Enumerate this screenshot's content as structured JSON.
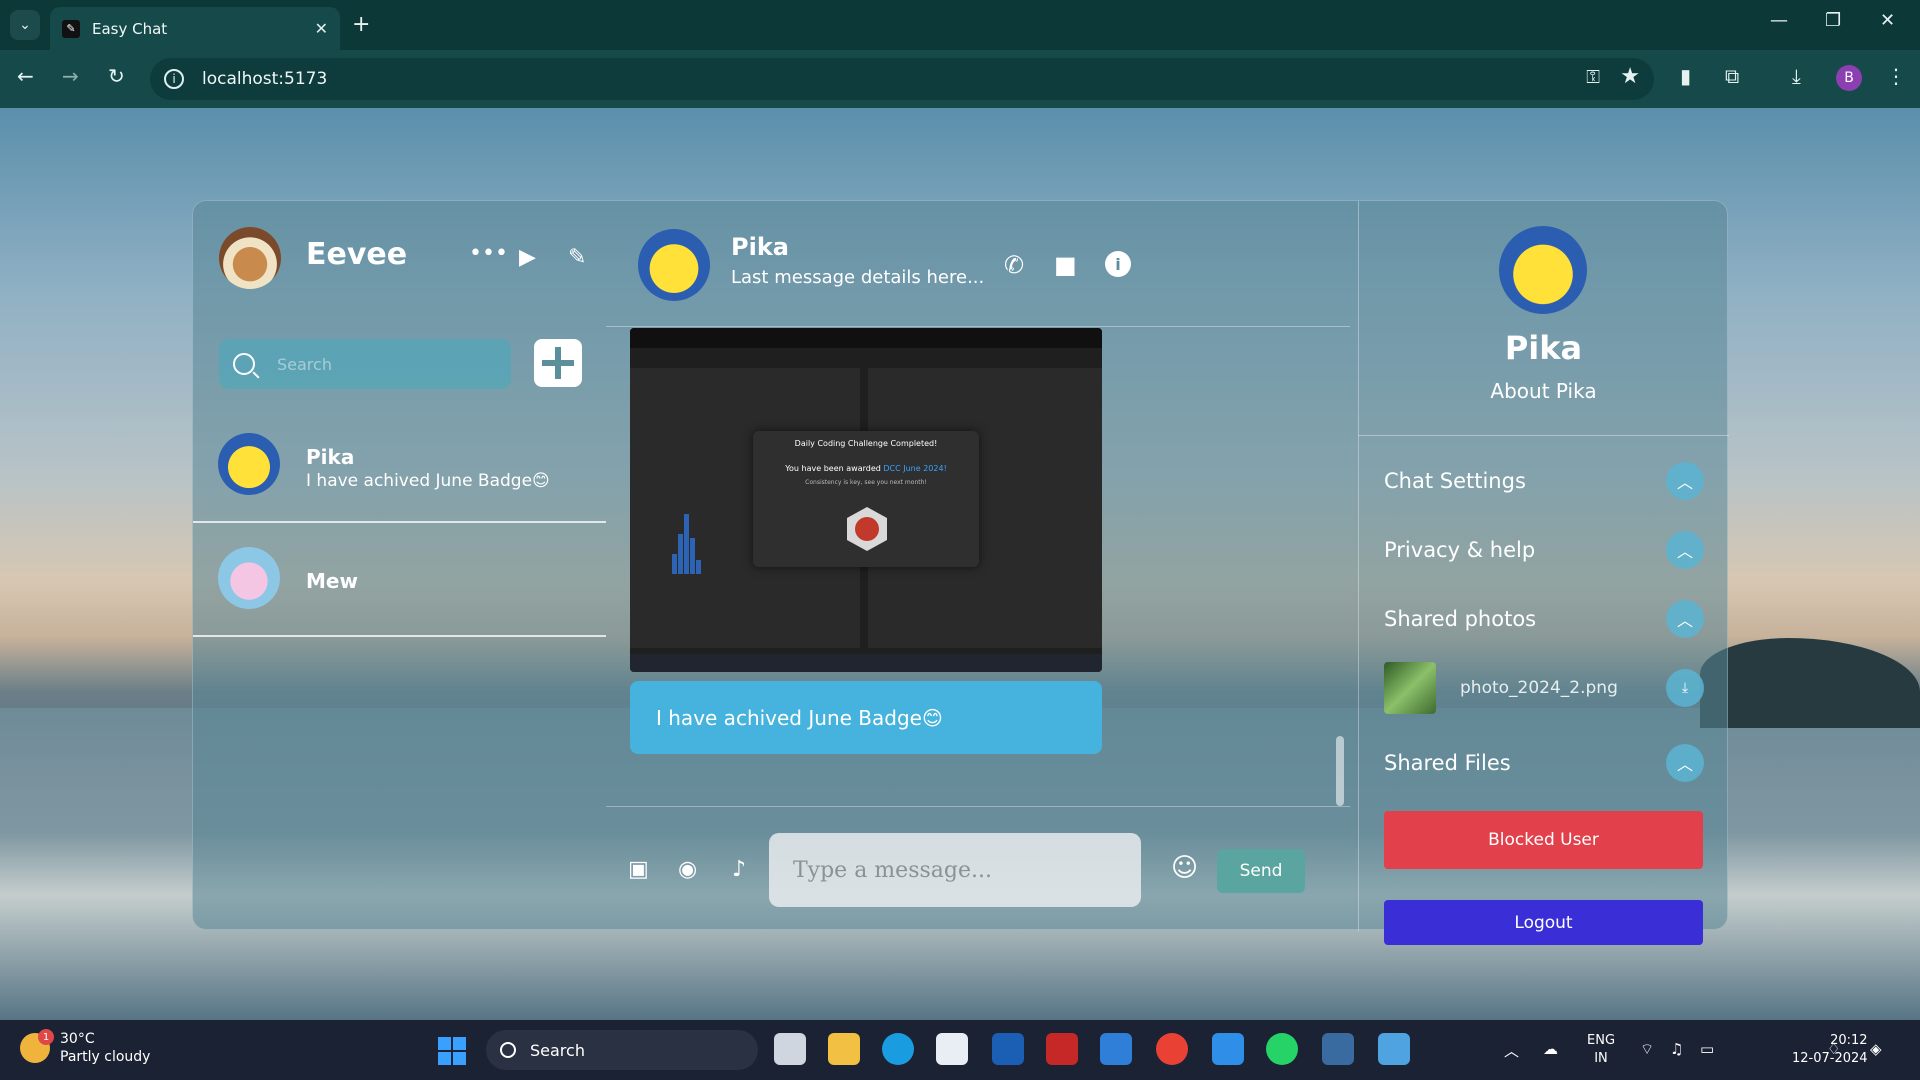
{
  "browser": {
    "tab_title": "Easy Chat",
    "url": "localhost:5173",
    "profile_initial": "B"
  },
  "current_user": {
    "name": "Eevee"
  },
  "search": {
    "placeholder": "Search"
  },
  "chat_list": [
    {
      "name": "Pika",
      "last_message": "I have achived June Badge😊"
    },
    {
      "name": "Mew",
      "last_message": ""
    }
  ],
  "chat_header": {
    "name": "Pika",
    "subtitle": "Last message details here..."
  },
  "messages": [
    {
      "type": "image",
      "modal_title": "Daily Coding Challenge Completed!",
      "modal_text": "You have been awarded",
      "modal_link": "DCC June 2024!",
      "modal_sub": "Consistency is key, see you next month!"
    },
    {
      "type": "text",
      "text": "I have achived June Badge😊"
    }
  ],
  "composer": {
    "placeholder": "Type a message...",
    "send_label": "Send"
  },
  "details": {
    "name": "Pika",
    "about": "About Pika",
    "sections": [
      "Chat Settings",
      "Privacy & help",
      "Shared photos",
      "Shared Files"
    ],
    "shared_photo": "photo_2024_2.png",
    "blocked_label": "Blocked User",
    "logout_label": "Logout"
  },
  "taskbar": {
    "temperature": "30°C",
    "weather": "Partly cloudy",
    "weather_badge": "1",
    "search_label": "Search",
    "lang_top": "ENG",
    "lang_bottom": "IN",
    "time": "20:12",
    "date": "12-07-2024"
  },
  "colors": {
    "blocked": "#e2404a",
    "logout": "#3a2fd6",
    "bubble": "#45b3dd",
    "send": "#5aa5a0"
  }
}
